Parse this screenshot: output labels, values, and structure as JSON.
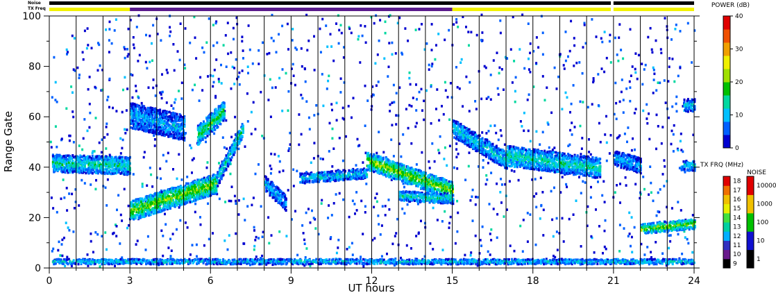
{
  "chart_data": {
    "type": "heatmap",
    "xlabel": "UT hours",
    "ylabel": "Range Gate",
    "xlim": [
      0,
      24
    ],
    "ylim": [
      0,
      100
    ],
    "x_ticks": [
      "0",
      "3",
      "6",
      "9",
      "12",
      "15",
      "18",
      "21",
      "24"
    ],
    "x_tick_values": [
      0,
      3,
      6,
      9,
      12,
      15,
      18,
      21,
      24
    ],
    "y_ticks": [
      "0",
      "20",
      "40",
      "60",
      "80",
      "100"
    ],
    "y_tick_values": [
      0,
      20,
      40,
      60,
      80,
      100
    ],
    "vertical_hour_lines": [
      1,
      2,
      3,
      4,
      5,
      6,
      7,
      8,
      9,
      10,
      11,
      12,
      13,
      14,
      15,
      16,
      17,
      18,
      19,
      20,
      21,
      22,
      23
    ],
    "top_bars": {
      "noise_label": "Noise",
      "txfreq_label": "TX Freq",
      "noise_segments": [
        {
          "from": 0,
          "to": 20.9,
          "color": "#000000"
        },
        {
          "from": 21.0,
          "to": 24,
          "color": "#000000"
        }
      ],
      "txfreq_segments": [
        {
          "from": 0,
          "to": 3,
          "color": "#f2f200"
        },
        {
          "from": 3,
          "to": 15,
          "color": "#5a1a8c"
        },
        {
          "from": 15,
          "to": 20.9,
          "color": "#f2f200"
        },
        {
          "from": 21.0,
          "to": 24,
          "color": "#f2f200"
        }
      ]
    },
    "echo_bands": [
      {
        "x_from": 0.1,
        "x_to": 3.0,
        "center_from": 41,
        "center_to": 40,
        "width": 7,
        "power": 12
      },
      {
        "x_from": 3.0,
        "x_to": 6.2,
        "center_from": 22,
        "center_to": 33,
        "width": 8,
        "power": 18
      },
      {
        "x_from": 6.2,
        "x_to": 7.2,
        "center_from": 34,
        "center_to": 55,
        "width": 6,
        "power": 12
      },
      {
        "x_from": 3.0,
        "x_to": 5.0,
        "center_from": 60,
        "center_to": 55,
        "width": 10,
        "power": 8
      },
      {
        "x_from": 5.5,
        "x_to": 6.5,
        "center_from": 52,
        "center_to": 62,
        "width": 8,
        "power": 15
      },
      {
        "x_from": 8.0,
        "x_to": 8.8,
        "center_from": 33,
        "center_to": 25,
        "width": 6,
        "power": 8
      },
      {
        "x_from": 9.3,
        "x_to": 11.8,
        "center_from": 35,
        "center_to": 37,
        "width": 4,
        "power": 10
      },
      {
        "x_from": 11.8,
        "x_to": 15.0,
        "center_from": 42,
        "center_to": 30,
        "width": 7,
        "power": 18
      },
      {
        "x_from": 13.0,
        "x_to": 15.0,
        "center_from": 28,
        "center_to": 27,
        "width": 4,
        "power": 12
      },
      {
        "x_from": 15.0,
        "x_to": 17.0,
        "center_from": 55,
        "center_to": 42,
        "width": 7,
        "power": 10
      },
      {
        "x_from": 17.0,
        "x_to": 20.5,
        "center_from": 44,
        "center_to": 39,
        "width": 8,
        "power": 12
      },
      {
        "x_from": 21.0,
        "x_to": 22.0,
        "center_from": 43,
        "center_to": 40,
        "width": 6,
        "power": 8
      },
      {
        "x_from": 23.5,
        "x_to": 24.0,
        "center_from": 40,
        "center_to": 40,
        "width": 4,
        "power": 10
      },
      {
        "x_from": 22.0,
        "x_to": 24.0,
        "center_from": 15,
        "center_to": 17,
        "width": 4,
        "power": 18
      },
      {
        "x_from": 23.6,
        "x_to": 24.0,
        "center_from": 64,
        "center_to": 64,
        "width": 5,
        "power": 10
      },
      {
        "x_from": 0.1,
        "x_to": 24.0,
        "center_from": 2,
        "center_to": 2,
        "width": 2,
        "power": 10
      }
    ],
    "power_colorbar": {
      "title": "POWER (dB)",
      "ticks": [
        "0",
        "10",
        "20",
        "30",
        "40"
      ],
      "tick_values": [
        0,
        10,
        20,
        30,
        40
      ],
      "range": [
        0,
        40
      ],
      "colors": [
        "#0000d0",
        "#0060ff",
        "#00c0ff",
        "#00d8a0",
        "#00c000",
        "#a0e000",
        "#f0f000",
        "#f0a000",
        "#f05000",
        "#e00000"
      ]
    },
    "txfreq_colorbar": {
      "title": "TX FRQ (MHz)",
      "ticks": [
        "9",
        "10",
        "11",
        "12",
        "13",
        "14",
        "15",
        "16",
        "17",
        "18"
      ],
      "colors": [
        "#000000",
        "#6a1a8c",
        "#3030c0",
        "#00b0ff",
        "#00d0a0",
        "#40e040",
        "#e8f000",
        "#f0c000",
        "#f07000",
        "#e00000"
      ]
    },
    "noise_colorbar": {
      "title": "NOISE",
      "ticks": [
        "1",
        "10",
        "100",
        "1000",
        "10000"
      ],
      "colors": [
        "#000000",
        "#1010d0",
        "#00c000",
        "#f0c000",
        "#e00000"
      ]
    }
  }
}
